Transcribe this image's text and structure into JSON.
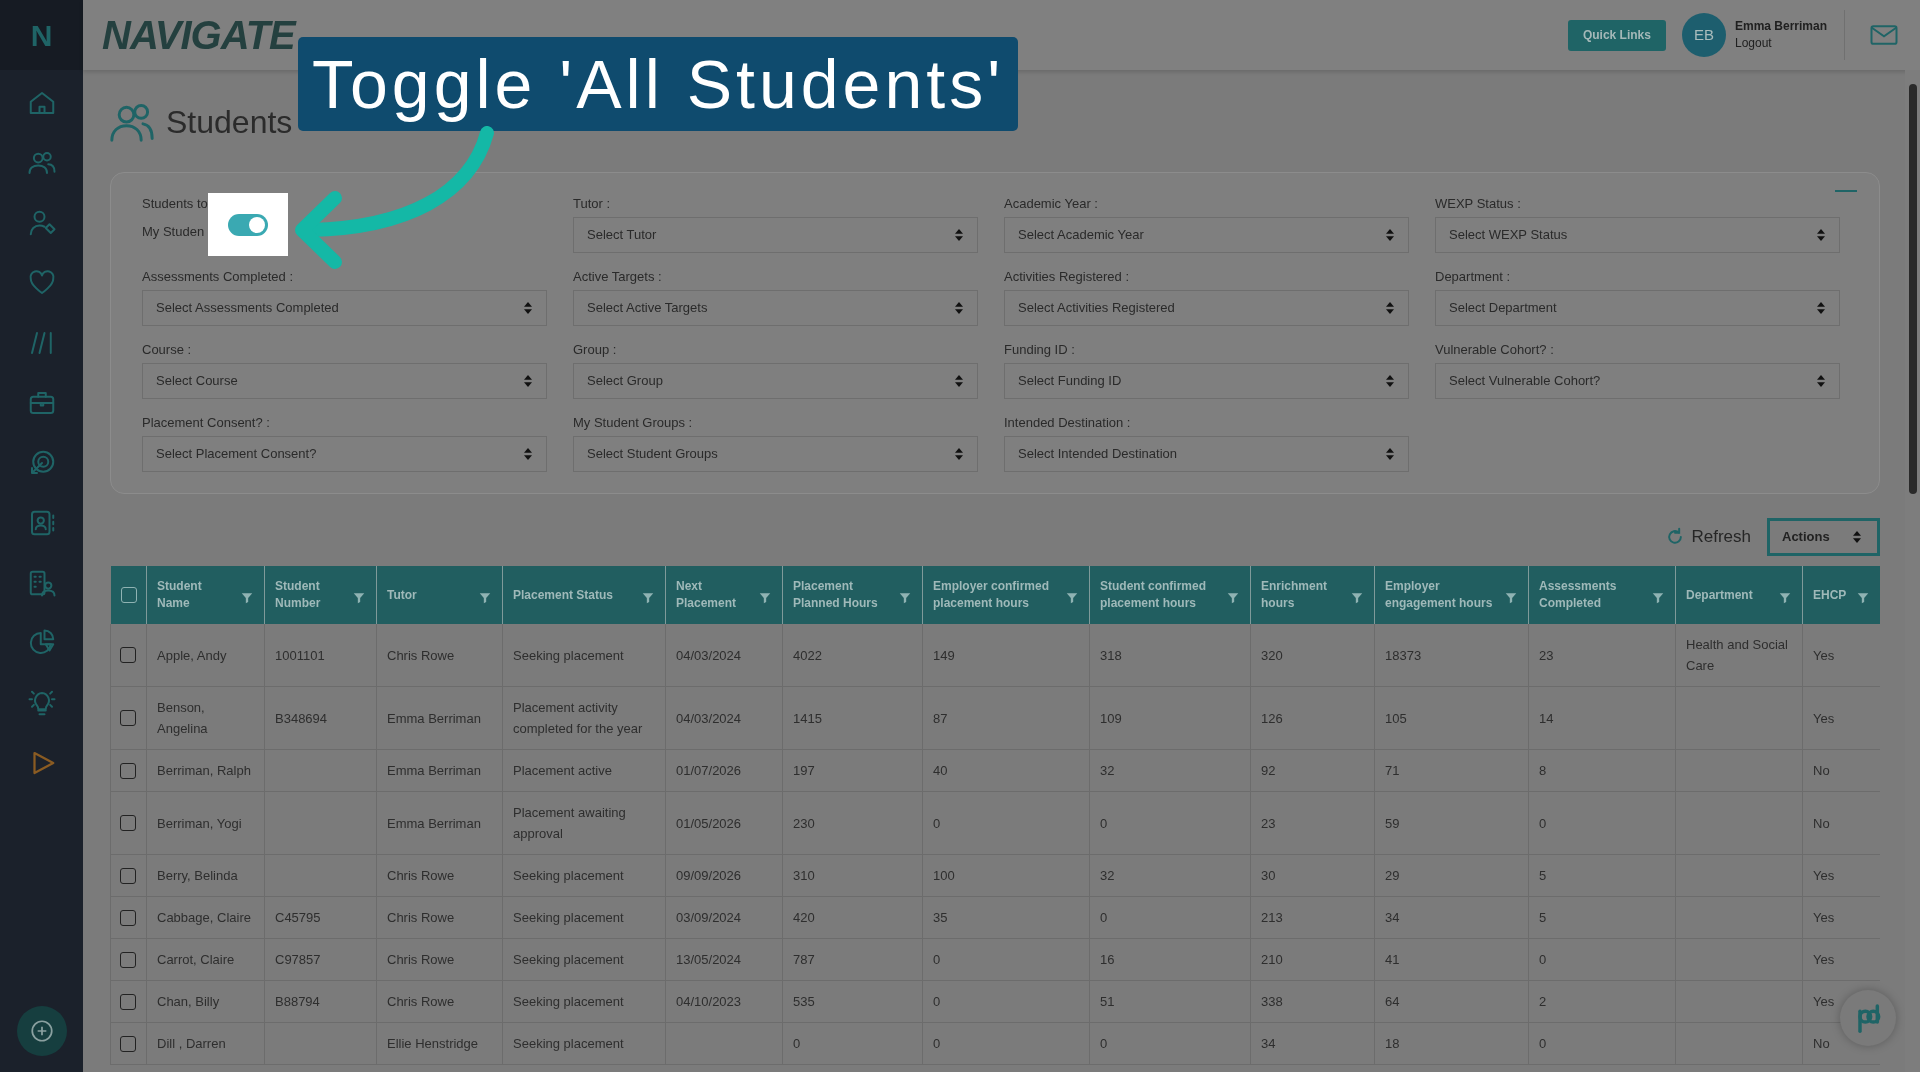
{
  "sidebar": {
    "logo": "N"
  },
  "header": {
    "logo": "NAVIGATE",
    "quick_links": "Quick Links",
    "user": {
      "initials": "EB",
      "name": "Emma Berriman",
      "logout": "Logout"
    }
  },
  "page_title": "Students",
  "tutorial": {
    "callout": "Toggle 'All Students'"
  },
  "filters": {
    "students_to_view": {
      "label": "Students to",
      "option": "My Studen",
      "on": true
    },
    "fields": [
      {
        "label": "Tutor :",
        "placeholder": "Select Tutor"
      },
      {
        "label": "Academic Year :",
        "placeholder": "Select Academic Year"
      },
      {
        "label": "WEXP Status :",
        "placeholder": "Select WEXP Status"
      },
      {
        "label": "Assessments Completed :",
        "placeholder": "Select Assessments Completed"
      },
      {
        "label": "Active Targets :",
        "placeholder": "Select Active Targets"
      },
      {
        "label": "Activities Registered :",
        "placeholder": "Select Activities Registered"
      },
      {
        "label": "Department :",
        "placeholder": "Select Department"
      },
      {
        "label": "Course :",
        "placeholder": "Select Course"
      },
      {
        "label": "Group :",
        "placeholder": "Select Group"
      },
      {
        "label": "Funding ID :",
        "placeholder": "Select Funding ID"
      },
      {
        "label": "Vulnerable Cohort? :",
        "placeholder": "Select Vulnerable Cohort?"
      },
      {
        "label": "Placement Consent? :",
        "placeholder": "Select Placement Consent?"
      },
      {
        "label": "My Student Groups :",
        "placeholder": "Select Student Groups"
      },
      {
        "label": "Intended Destination :",
        "placeholder": "Select Intended Destination"
      }
    ]
  },
  "toolbar": {
    "refresh": "Refresh",
    "actions": "Actions"
  },
  "table": {
    "select_all_checked": false,
    "columns": [
      "Student Name",
      "Student Number",
      "Tutor",
      "Placement Status",
      "Next Placement",
      "Placement Planned Hours",
      "Employer confirmed placement hours",
      "Student confirmed placement hours",
      "Enrichment hours",
      "Employer engagement hours",
      "Assessments Completed",
      "Department",
      "EHCP"
    ],
    "rows": [
      {
        "checked": false,
        "cells": [
          "Apple, Andy",
          "1001101",
          "Chris Rowe",
          "Seeking placement",
          "04/03/2024",
          "4022",
          "149",
          "318",
          "320",
          "18373",
          "23",
          "Health and Social Care",
          "Yes"
        ]
      },
      {
        "checked": false,
        "cells": [
          "Benson, Angelina",
          "B348694",
          "Emma Berriman",
          "Placement activity completed for the year",
          "04/03/2024",
          "1415",
          "87",
          "109",
          "126",
          "105",
          "14",
          null,
          "Yes"
        ]
      },
      {
        "checked": false,
        "cells": [
          "Berriman, Ralph",
          null,
          "Emma Berriman",
          "Placement active",
          "01/07/2026",
          "197",
          "40",
          "32",
          "92",
          "71",
          "8",
          null,
          "No"
        ]
      },
      {
        "checked": false,
        "cells": [
          "Berriman, Yogi",
          null,
          "Emma Berriman",
          "Placement awaiting approval",
          "01/05/2026",
          "230",
          "0",
          "0",
          "23",
          "59",
          "0",
          null,
          "No"
        ]
      },
      {
        "checked": false,
        "cells": [
          "Berry, Belinda",
          null,
          "Chris Rowe",
          "Seeking placement",
          "09/09/2026",
          "310",
          "100",
          "32",
          "30",
          "29",
          "5",
          null,
          "Yes"
        ]
      },
      {
        "checked": false,
        "cells": [
          "Cabbage, Claire",
          "C45795",
          "Chris Rowe",
          "Seeking placement",
          "03/09/2024",
          "420",
          "35",
          "0",
          "213",
          "34",
          "5",
          null,
          "Yes"
        ]
      },
      {
        "checked": false,
        "cells": [
          "Carrot, Claire",
          "C97857",
          "Chris Rowe",
          "Seeking placement",
          "13/05/2024",
          "787",
          "0",
          "16",
          "210",
          "41",
          "0",
          null,
          "Yes"
        ]
      },
      {
        "checked": false,
        "cells": [
          "Chan, Billy",
          "B88794",
          "Chris Rowe",
          "Seeking placement",
          "04/10/2023",
          "535",
          "0",
          "51",
          "338",
          "64",
          "2",
          null,
          "Yes"
        ]
      },
      {
        "checked": false,
        "cells": [
          "Dill , Darren",
          null,
          "Ellie Henstridge",
          "Seeking placement",
          null,
          "0",
          "0",
          "0",
          "34",
          "18",
          "0",
          null,
          "No"
        ]
      }
    ]
  }
}
